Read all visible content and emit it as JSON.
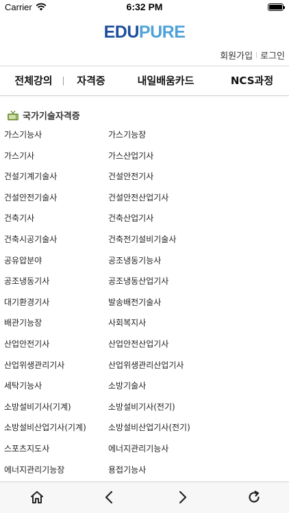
{
  "status_bar": {
    "carrier": "Carrier",
    "time": "6:32 PM",
    "battery_level": 1.0
  },
  "header": {
    "logo_part1": "EDU",
    "logo_part2": "PURE",
    "signup": "회원가입",
    "auth_sep": "|",
    "login": "로그인"
  },
  "nav": {
    "tabs": [
      {
        "label": "전체강의"
      },
      {
        "label": "자격증"
      },
      {
        "label": "내일배움카드"
      },
      {
        "label": "NCS과정"
      }
    ]
  },
  "section": {
    "title": "국가기술자격증",
    "icon": "tv-icon"
  },
  "courses": {
    "rows": [
      [
        "가스기능사",
        "가스기능장"
      ],
      [
        "가스기사",
        "가스산업기사"
      ],
      [
        "건설기계기술사",
        "건설안전기사"
      ],
      [
        "건설안전기술사",
        "건설안전산업기사"
      ],
      [
        "건축기사",
        "건축산업기사"
      ],
      [
        "건축시공기술사",
        "건축전기설비기술사"
      ],
      [
        "공유압분야",
        "공조냉동기능사"
      ],
      [
        "공조냉동기사",
        "공조냉동산업기사"
      ],
      [
        "대기환경기사",
        "발송배전기술사"
      ],
      [
        "배관기능장",
        "사회복지사"
      ],
      [
        "산업안전기사",
        "산업안전산업기사"
      ],
      [
        "산업위생관리기사",
        "산업위생관리산업기사"
      ],
      [
        "세탁기능사",
        "소방기술사"
      ],
      [
        "소방설비기사(기계)",
        "소방설비기사(전기)"
      ],
      [
        "소방설비산업기사(기계)",
        "소방설비산업기사(전기)"
      ],
      [
        "스포츠지도사",
        "에너지관리기능사"
      ],
      [
        "에너지관리기능장",
        "용접기능사"
      ]
    ]
  },
  "toolbar": {
    "icons": [
      "home-icon",
      "back-icon",
      "forward-icon",
      "refresh-icon"
    ]
  },
  "colors": {
    "logo_dark": "#1d4e9a",
    "logo_light": "#4fa2d8",
    "toolbar_bg": "#f7f7f7"
  }
}
